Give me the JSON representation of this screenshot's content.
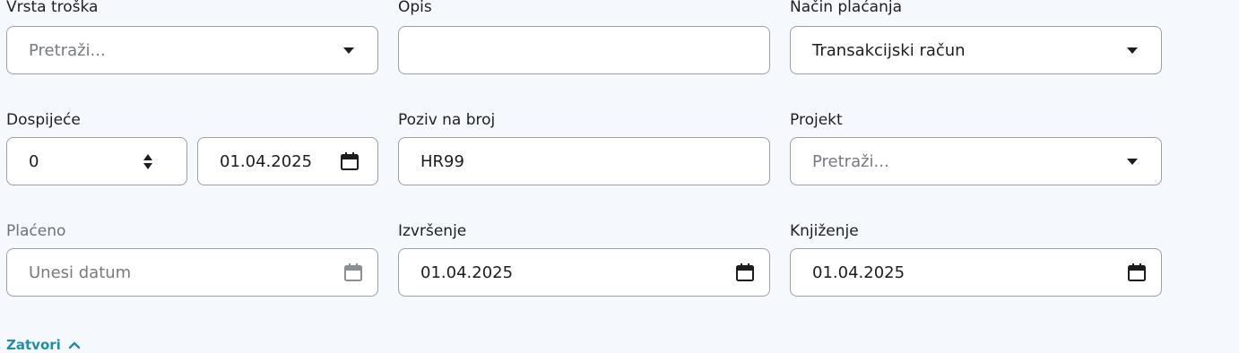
{
  "row1": {
    "vrsta": {
      "label": "Vrsta troška",
      "placeholder": "Pretraži..."
    },
    "opis": {
      "label": "Opis",
      "value": ""
    },
    "nacin": {
      "label": "Način plaćanja",
      "value": "Transakcijski račun"
    }
  },
  "row2": {
    "dospijece": {
      "label": "Dospijeće",
      "days": "0",
      "date": "01.04.2025"
    },
    "poziv": {
      "label": "Poziv na broj",
      "value": "HR99"
    },
    "projekt": {
      "label": "Projekt",
      "placeholder": "Pretraži..."
    }
  },
  "row3": {
    "placeno": {
      "label": "Plaćeno",
      "placeholder": "Unesi datum"
    },
    "izvrsenje": {
      "label": "Izvršenje",
      "value": "01.04.2025"
    },
    "knjizenje": {
      "label": "Knjiženje",
      "value": "01.04.2025"
    }
  },
  "footer": {
    "close_label": "Zatvori"
  },
  "icons": {
    "dropdown": "caret-down-icon",
    "calendar": "calendar-icon",
    "spinner": "spinner-icon",
    "collapse": "chevron-up-icon"
  },
  "colors": {
    "accent": "#1f8ea8",
    "border": "#9aa0a6",
    "background": "#f5f8fc"
  }
}
